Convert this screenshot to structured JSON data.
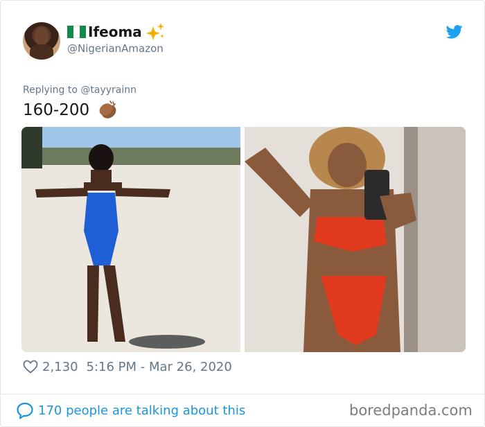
{
  "tweet": {
    "author": {
      "display_name": "Ifeoma",
      "handle": "@NigerianAmazon",
      "flag_icon": "nigeria-flag-icon",
      "badge_icon": "sparkles-icon"
    },
    "brand_icon": "twitter-bird-icon",
    "replying_to": "Replying to @tayyrainn",
    "text": "160-200",
    "text_icon": "clapping-hands-icon",
    "media": [
      {
        "description": "woman in blue cutout swimsuit on a beach"
      },
      {
        "description": "woman in red patterned bikini taking mirror selfie"
      }
    ],
    "likes": "2,130",
    "timestamp": "5:16 PM - Mar 26, 2020",
    "conversation": "170 people are talking about this"
  },
  "watermark": "boredpanda.com",
  "colors": {
    "twitter_blue": "#1da1f2",
    "link_blue": "#1b95e0",
    "muted_gray": "#657786",
    "text": "#14171a"
  }
}
